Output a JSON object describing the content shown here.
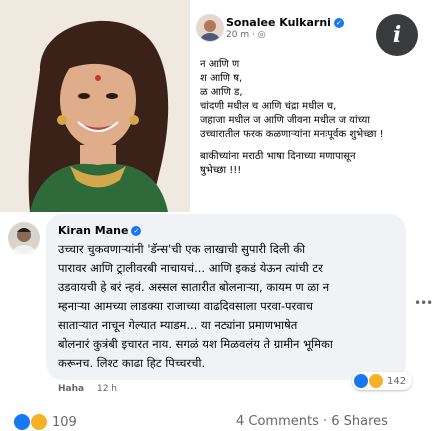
{
  "post": {
    "author": "Sonalee Kulkarni",
    "meta": "20 m ·",
    "lines": [
      "न आणि ण",
      "श आणि ष,",
      "ळ आणि ड,",
      "चांदणी मधील च आणि चंद्रा मधील च,",
      "जहाजा मधील ज आणि जीवना मधील ज यांच्या",
      "उच्चारातील फरक कळणाऱ्यांना मनःपूर्वक शुभेच्छा !"
    ],
    "lines2": [
      "बाकीच्यांना मराठी भाषा दिनाच्या मणापासून",
      "षुभेच्छा !!!"
    ],
    "info_label": "i"
  },
  "comment": {
    "name": "Kiran Mane",
    "lines": [
      "उच्चार चुकवणाऱ्यांनी 'डॅन्स'ची एक लाखाची सुपारी दिली की",
      "पारावर आणि ट्रालीवरबी नाचायचं... आणि इकडं येऊन त्यांची टर",
      "उडवायची हे बरं न्हवं. अस्सल सातारीत बोलनाऱ्या, कायम ण ळा न",
      "म्हनाऱ्या आमच्या लाडक्या राजाच्या वाढदिवसाला परवा-परवाच",
      "साताऱ्यात नाचून गेल्यात म्याडम... या नट्यांना प्रमाणभाषेत",
      "बोलनारं कुत्रंबी इचारत नाय. सगळं यश मिळवलंय ते ग्रामीन भूमिका",
      "करूनच. लिश्ट काढा हिट पिच्चरची."
    ],
    "action": "Haha",
    "time": "12 h",
    "reaction_count": "142"
  },
  "footer": {
    "reaction_count": "109",
    "counts": "4 Comments · 6 Shares"
  }
}
